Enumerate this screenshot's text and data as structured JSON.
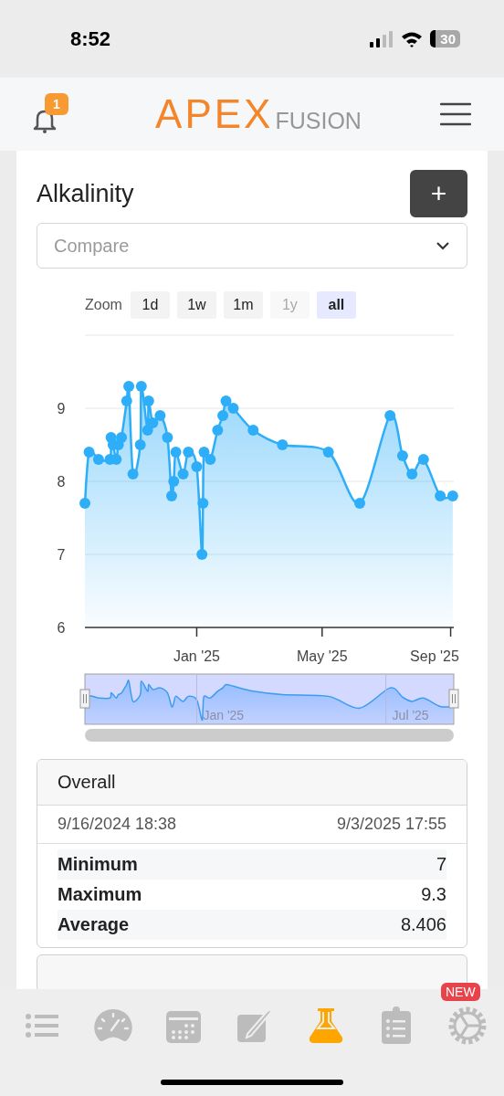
{
  "status_bar": {
    "time": "8:52",
    "battery": "30"
  },
  "header": {
    "notifications": "1",
    "logo_main": "APEX",
    "logo_sub": "FUSION"
  },
  "title": "Alkalinity",
  "add_button": "+",
  "compare": {
    "placeholder": "Compare"
  },
  "zoom": {
    "label": "Zoom",
    "buttons": [
      {
        "label": "1d",
        "selected": false,
        "disabled": false
      },
      {
        "label": "1w",
        "selected": false,
        "disabled": false
      },
      {
        "label": "1m",
        "selected": false,
        "disabled": false
      },
      {
        "label": "1y",
        "selected": false,
        "disabled": true
      },
      {
        "label": "all",
        "selected": true,
        "disabled": false
      }
    ]
  },
  "chart_data": {
    "type": "area",
    "grid": true,
    "xlim": [
      "2024-09-16",
      "2025-09-04"
    ],
    "ylim": [
      6,
      10
    ],
    "yticks": [
      6,
      7,
      8,
      9
    ],
    "xticks": [
      {
        "value": "2025-01-01",
        "label": "Jan '25"
      },
      {
        "value": "2025-05-01",
        "label": "May '25"
      },
      {
        "value": "2025-09-01",
        "label": "Sep '25"
      }
    ],
    "series": [
      {
        "color": "#2eaef8",
        "x": [
          "2024-09-16",
          "2024-09-20",
          "2024-09-29",
          "2024-10-10",
          "2024-10-11",
          "2024-10-13",
          "2024-10-16",
          "2024-10-18",
          "2024-10-21",
          "2024-10-26",
          "2024-10-28",
          "2024-11-01",
          "2024-11-08",
          "2024-11-09",
          "2024-11-15",
          "2024-11-16",
          "2024-11-20",
          "2024-11-27",
          "2024-12-04",
          "2024-12-08",
          "2024-12-10",
          "2024-12-12",
          "2024-12-19",
          "2024-12-24",
          "2025-01-01",
          "2025-01-06",
          "2025-01-07",
          "2025-01-08",
          "2025-01-14",
          "2025-01-21",
          "2025-01-26",
          "2025-01-29",
          "2025-02-05",
          "2025-02-24",
          "2025-03-24",
          "2025-05-07",
          "2025-06-06",
          "2025-07-05",
          "2025-07-17",
          "2025-07-26",
          "2025-08-06",
          "2025-08-22",
          "2025-09-03"
        ],
        "values": [
          7.7,
          8.4,
          8.3,
          8.3,
          8.6,
          8.5,
          8.3,
          8.5,
          8.6,
          9.1,
          9.3,
          8.1,
          8.5,
          9.3,
          8.7,
          9.1,
          8.8,
          8.9,
          8.6,
          7.8,
          8.0,
          8.4,
          8.1,
          8.4,
          8.2,
          7.0,
          7.7,
          8.4,
          8.3,
          8.7,
          8.9,
          9.1,
          9.0,
          8.7,
          8.5,
          8.4,
          7.7,
          8.9,
          8.35,
          8.1,
          8.3,
          7.8,
          7.8
        ]
      }
    ]
  },
  "navigator": {
    "ticks": [
      {
        "label": "Jan '25"
      },
      {
        "label": "Jul '25"
      }
    ]
  },
  "stats": {
    "title": "Overall",
    "start": "9/16/2024 18:38",
    "end": "9/3/2025 17:55",
    "rows": [
      {
        "label": "Minimum",
        "value": "7"
      },
      {
        "label": "Maximum",
        "value": "9.3"
      },
      {
        "label": "Average",
        "value": "8.406"
      }
    ]
  },
  "tabbar": {
    "items": [
      {
        "kind": "list",
        "selected": false
      },
      {
        "kind": "gauge",
        "selected": false
      },
      {
        "kind": "calendar",
        "selected": false
      },
      {
        "kind": "edit",
        "selected": false
      },
      {
        "kind": "flask",
        "selected": true
      },
      {
        "kind": "clipboard",
        "selected": false
      },
      {
        "kind": "gear",
        "selected": false,
        "badge": "NEW"
      }
    ]
  }
}
